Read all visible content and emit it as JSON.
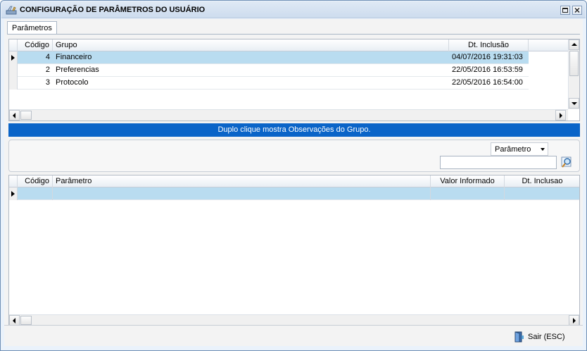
{
  "window": {
    "title": "CONFIGURAÇÃO DE PARÂMETROS DO USUÁRIO",
    "icons": {
      "app": "tools-icon",
      "maximize": "maximize-icon",
      "close": "close-icon"
    }
  },
  "tabs": [
    {
      "label": "Parâmetros",
      "active": true
    }
  ],
  "groups_grid": {
    "columns": [
      "Código",
      "Grupo",
      "Dt. Inclusão"
    ],
    "rows": [
      {
        "codigo": "4",
        "grupo": "Financeiro",
        "dt_inclusao": "04/07/2016 19:31:03",
        "selected": true
      },
      {
        "codigo": "2",
        "grupo": "Preferencias",
        "dt_inclusao": "22/05/2016 16:53:59",
        "selected": false
      },
      {
        "codigo": "3",
        "grupo": "Protocolo",
        "dt_inclusao": "22/05/2016 16:54:00",
        "selected": false
      }
    ]
  },
  "banner": {
    "text": "Duplo clique mostra Observações do Grupo."
  },
  "filter": {
    "field_selected": "Parâmetro",
    "search_value": "",
    "search_icon": "magnifier-icon"
  },
  "params_grid": {
    "columns": [
      "Código",
      "Parâmetro",
      "Valor Informado",
      "Dt. Inclusao"
    ],
    "rows": []
  },
  "footer": {
    "exit_label": "Sair (ESC)",
    "exit_icon": "door-exit-icon"
  },
  "colors": {
    "banner_bg": "#0a64c8",
    "selection": "#b9dcf0",
    "window_border": "#6f8fb5"
  }
}
